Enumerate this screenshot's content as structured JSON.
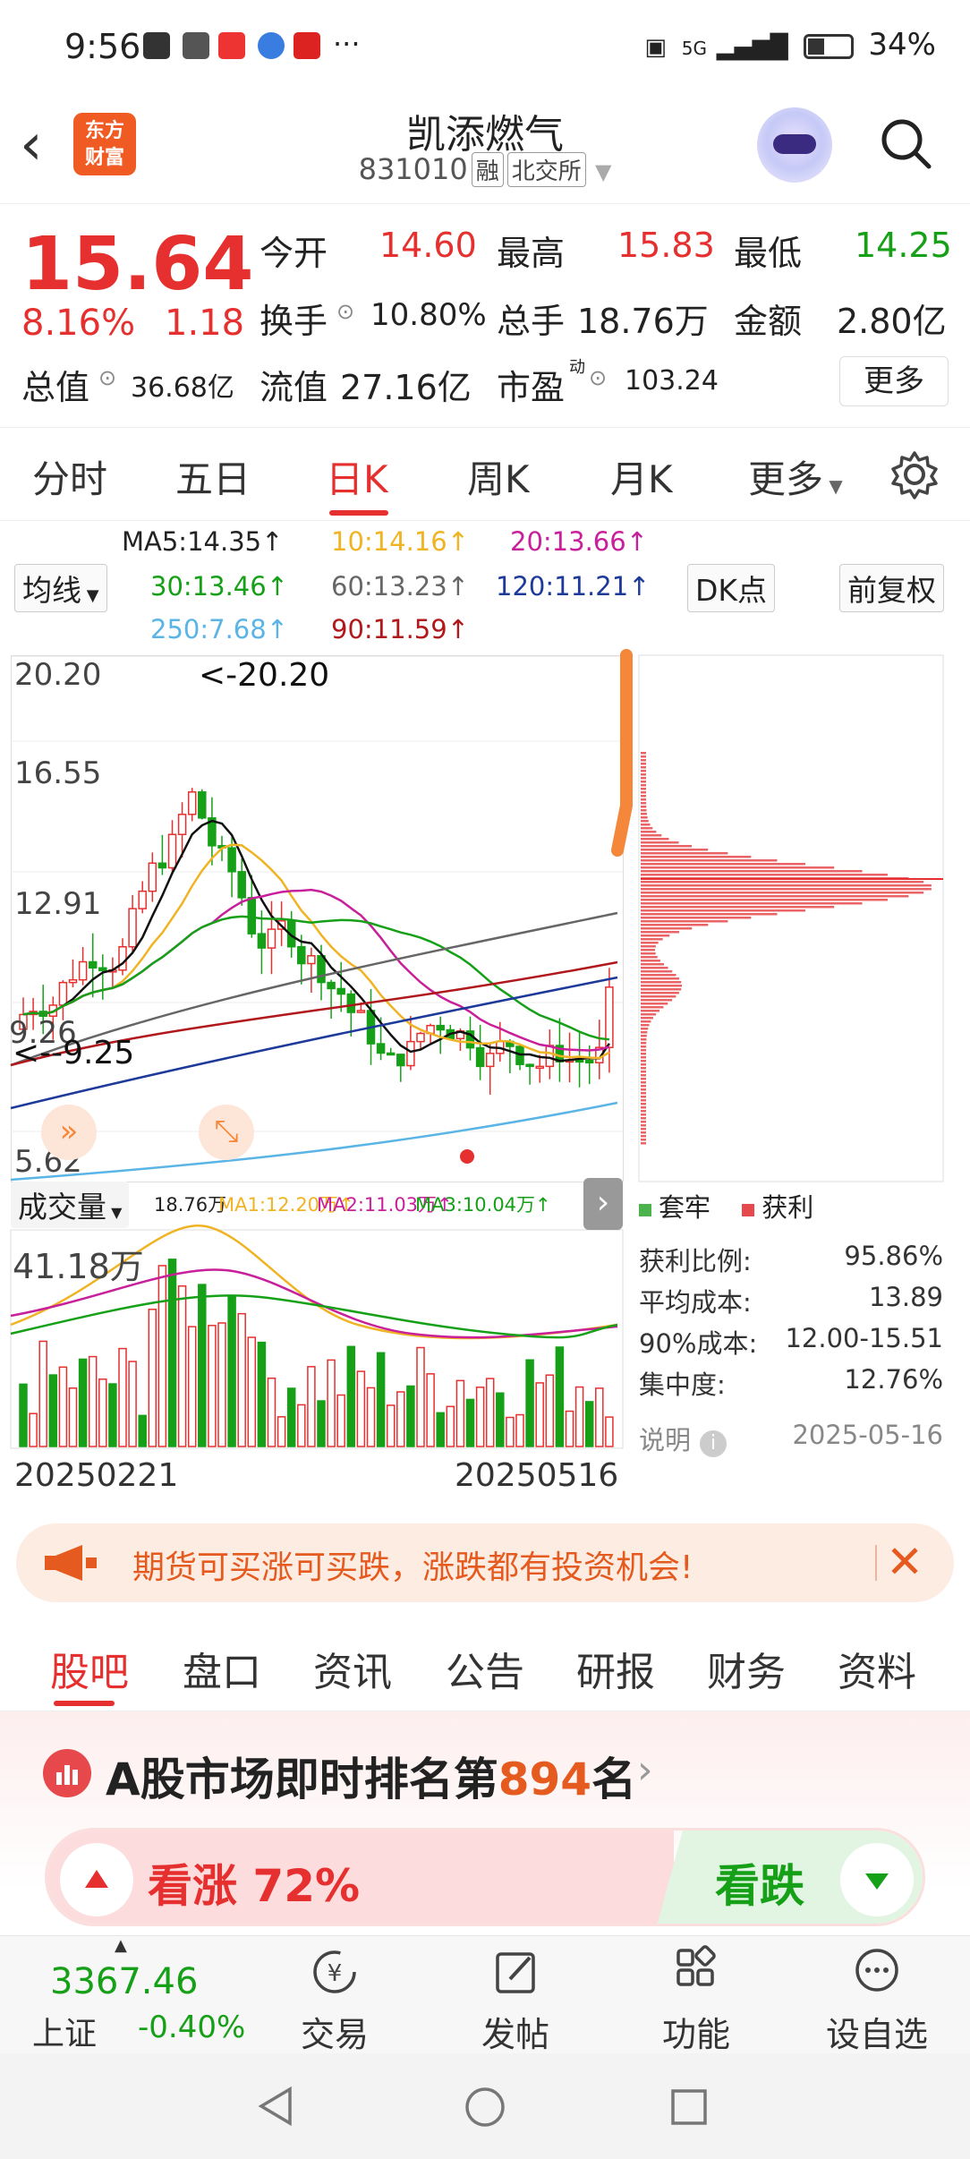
{
  "status": {
    "time": "9:56",
    "icons_text": "···",
    "signal": "5G",
    "battery": "34%"
  },
  "header": {
    "title": "凯添燃气",
    "code": "831010",
    "tag_rong": "融",
    "tag_market": "北交所",
    "logo_line1": "东方",
    "logo_line2": "财富"
  },
  "quote": {
    "price": "15.64",
    "pct": "8.16%",
    "change": "1.18",
    "open_label": "今开",
    "open": "14.60",
    "high_label": "最高",
    "high": "15.83",
    "low_label": "最低",
    "low": "14.25",
    "turnover_label": "换手",
    "turnover": "10.80%",
    "volume_label": "总手",
    "volume": "18.76万",
    "amount_label": "金额",
    "amount": "2.80亿",
    "mktcap_label": "总值",
    "mktcap": "36.68亿",
    "float_label": "流值",
    "float": "27.16亿",
    "pe_label": "市盈",
    "pe_sup": "动",
    "pe": "103.24",
    "more": "更多"
  },
  "tabs": [
    "分时",
    "五日",
    "日K",
    "周K",
    "月K",
    "更多"
  ],
  "active_tab": "日K",
  "ma": {
    "selector": "均线",
    "ma5": "MA5:14.35↑",
    "ma10": "10:14.16↑",
    "ma20": "20:13.66↑",
    "ma30": "30:13.46↑",
    "ma60": "60:13.23↑",
    "ma120": "120:11.21↑",
    "ma250": "250:7.68↑",
    "ma90": "90:11.59↑",
    "dk": "DK点",
    "fq": "前复权"
  },
  "chart": {
    "y_labels": [
      "20.20",
      "16.55",
      "12.91",
      "9.26",
      "5.62"
    ],
    "high_mark": "<-20.20",
    "low_mark": "<--9.25",
    "vol_selector": "成交量",
    "vol_info": "18.76万",
    "vol_ma1": "MA1:12.20万↑",
    "vol_ma2": "MA2:11.03万↑",
    "vol_ma3": "MA3:10.04万↑",
    "vol_max": "41.18万",
    "date_start": "20250221",
    "date_end": "20250516"
  },
  "chips": {
    "legend_trap": "套牢",
    "legend_profit": "获利",
    "rows": [
      [
        "获利比例:",
        "95.86%"
      ],
      [
        "平均成本:",
        "13.89"
      ],
      [
        "90%成本:",
        "12.00-15.51"
      ],
      [
        "集中度:",
        "12.76%"
      ]
    ],
    "note": "说明",
    "date": "2025-05-16"
  },
  "banner": "期货可买涨可买跌，涨跌都有投资机会!",
  "bottom_tabs": [
    "股吧",
    "盘口",
    "资讯",
    "公告",
    "研报",
    "财务",
    "资料"
  ],
  "rank": {
    "prefix": "A股市场即时排名第",
    "number": "894",
    "suffix": "名"
  },
  "vote": {
    "up": "看涨 72%",
    "down": "看跌"
  },
  "index": {
    "value": "3367.46",
    "name": "上证",
    "pct": "-0.40%"
  },
  "nav": [
    "交易",
    "发帖",
    "功能",
    "设自选"
  ],
  "colors": {
    "up": "#e6302f",
    "down": "#16a018",
    "accent": "#f05a23"
  }
}
